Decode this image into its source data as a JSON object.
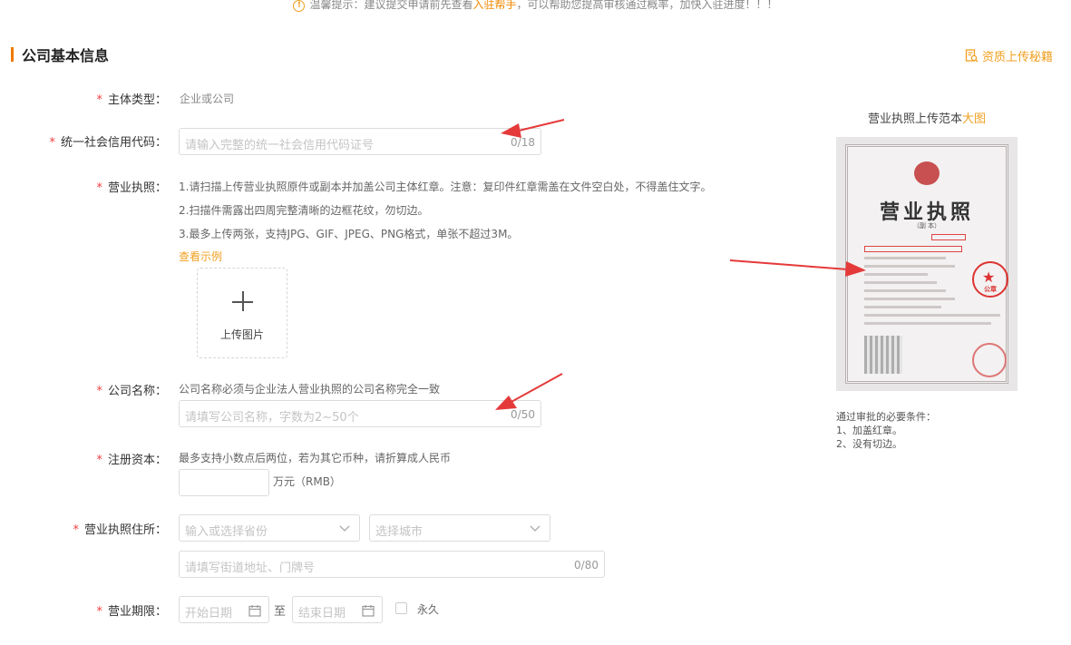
{
  "notice": {
    "icon": "warning-circle-icon",
    "prefix": "温馨提示：建议提交申请前先查看",
    "link": "入驻帮手",
    "suffix": "，可以帮助您提高审核通过概率，加快入驻进度！！！"
  },
  "section": {
    "title": "公司基本信息",
    "secret_link": "资质上传秘籍",
    "accent_color": "#f07800"
  },
  "fields": {
    "entity_type": {
      "label": "主体类型：",
      "value": "企业或公司"
    },
    "credit_code": {
      "label": "统一社会信用代码：",
      "placeholder": "请输入完整的统一社会信用代码证号",
      "counter": "0/18"
    },
    "license": {
      "label": "营业执照：",
      "hints": [
        "1.请扫描上传营业执照原件或副本并加盖公司主体红章。注意：复印件红章需盖在文件空白处，不得盖住文字。",
        "2.扫描件需露出四周完整清晰的边框花纹，勿切边。",
        "3.最多上传两张，支持JPG、GIF、JPEG、PNG格式，单张不超过3M。"
      ],
      "example_link": "查看示例",
      "upload_label": "上传图片"
    },
    "company_name": {
      "label": "公司名称：",
      "hint": "公司名称必须与企业法人营业执照的公司名称完全一致",
      "placeholder": "请填写公司名称，字数为2~50个",
      "counter": "0/50"
    },
    "capital": {
      "label": "注册资本：",
      "hint": "最多支持小数点后两位，若为其它币种，请折算成人民币",
      "unit": "万元（RMB）"
    },
    "address": {
      "label": "营业执照住所：",
      "province_placeholder": "输入或选择省份",
      "city_placeholder": "选择城市",
      "street_placeholder": "请填写街道地址、门牌号",
      "counter": "0/80"
    },
    "term": {
      "label": "营业期限：",
      "start_placeholder": "开始日期",
      "sep": "至",
      "end_placeholder": "结束日期",
      "forever": "永久"
    }
  },
  "sample": {
    "title": "营业执照上传范本",
    "big_link": "大图",
    "license_title": "营业执照",
    "license_sub": "（副 本）",
    "seal_text": "公章",
    "conditions_title": "通过审批的必要条件：",
    "conditions": [
      "1、加盖红章。",
      "2、没有切边。"
    ]
  }
}
